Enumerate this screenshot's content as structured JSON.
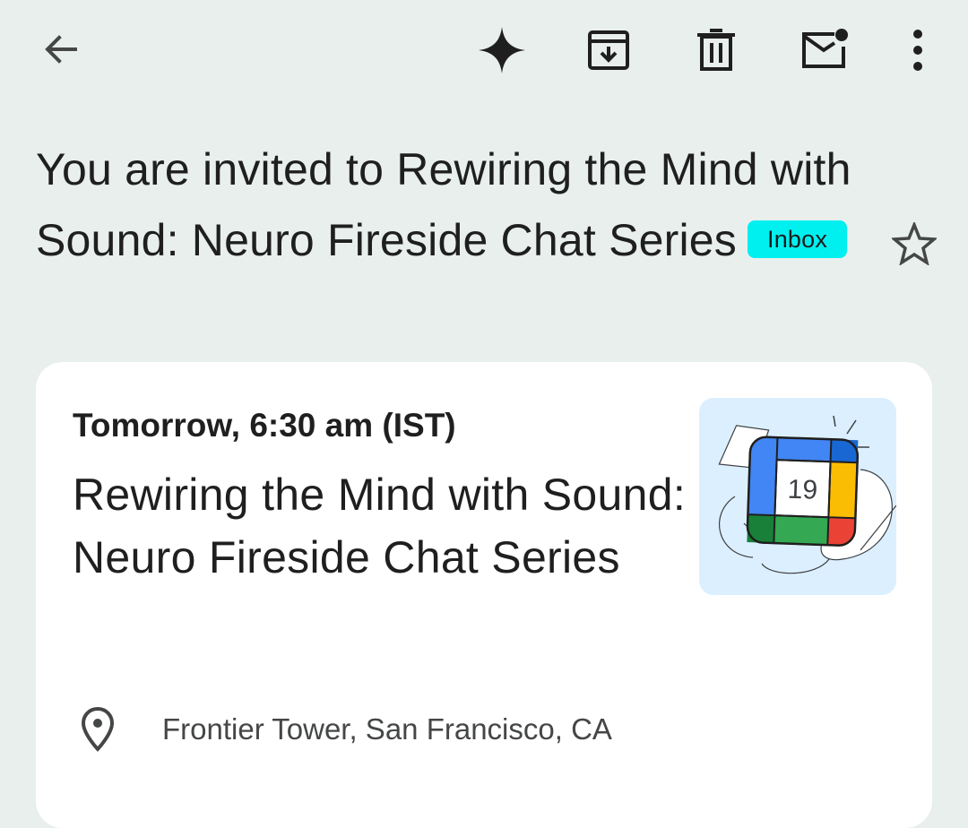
{
  "toolbar": {
    "back": "back-arrow-icon",
    "gemini": "gemini-sparkle-icon",
    "archive": "archive-icon",
    "delete": "trash-icon",
    "mark_unread": "mark-unread-icon",
    "more": "more-vert-icon"
  },
  "email": {
    "subject": "You are invited to Rewiring the Mind with Sound: Neuro Fireside Chat Series",
    "label": "Inbox",
    "starred": false
  },
  "event_card": {
    "time": "Tomorrow, 6:30 am (IST)",
    "title": "Rewiring the Mind with Sound: Neuro Fireside Chat Series",
    "calendar_day": "19",
    "location": "Frontier Tower, San Francisco, CA"
  },
  "colors": {
    "background": "#e8efed",
    "badge": "#00f0f0",
    "card": "#ffffff",
    "calendar_blue": "#4285f4",
    "calendar_green": "#34a853",
    "calendar_yellow": "#fbbc04",
    "calendar_red": "#ea4335"
  }
}
